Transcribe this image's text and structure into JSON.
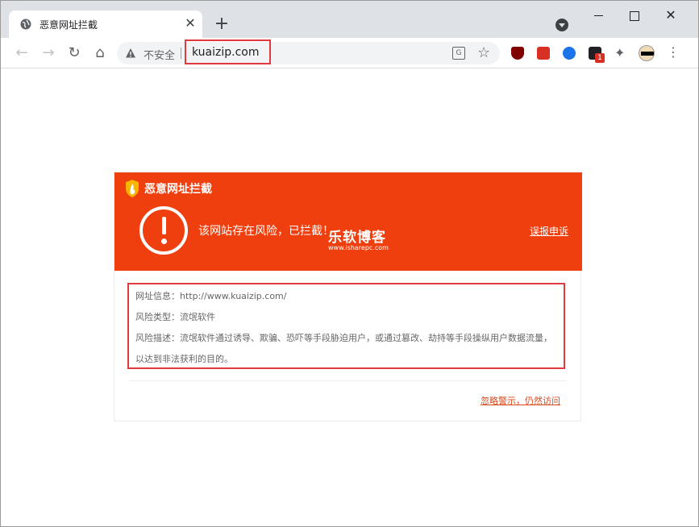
{
  "browser": {
    "tab": {
      "title": "恶意网址拦截",
      "close_label": "✕"
    },
    "new_tab_label": "+",
    "window_controls": {
      "close_label": "✕"
    },
    "toolbar": {
      "security_label": "不安全",
      "url": "kuaizip.com",
      "extension_badge": "1"
    }
  },
  "page": {
    "header_title": "恶意网址拦截",
    "risk_message": "该网站存在风险，已拦截！",
    "appeal_link": "误报申诉",
    "watermark": {
      "main": "乐软博客",
      "sub": "www.isharepc.com"
    },
    "info": {
      "site_label": "网址信息：",
      "site_value": "http://www.kuaizip.com/",
      "type_label": "风险类型：",
      "type_value": "流氓软件",
      "desc_label": "风险描述：",
      "desc_value": "流氓软件通过诱导、欺骗、恐吓等手段胁迫用户，或通过篡改、劫持等手段操纵用户数据流量，以达到非法获利的目的。"
    },
    "ignore_link": "忽略警示，仍然访问"
  },
  "colors": {
    "header_bg": "#ef3f0e",
    "highlight_border": "#e03a3e",
    "link": "#d74a1d"
  }
}
